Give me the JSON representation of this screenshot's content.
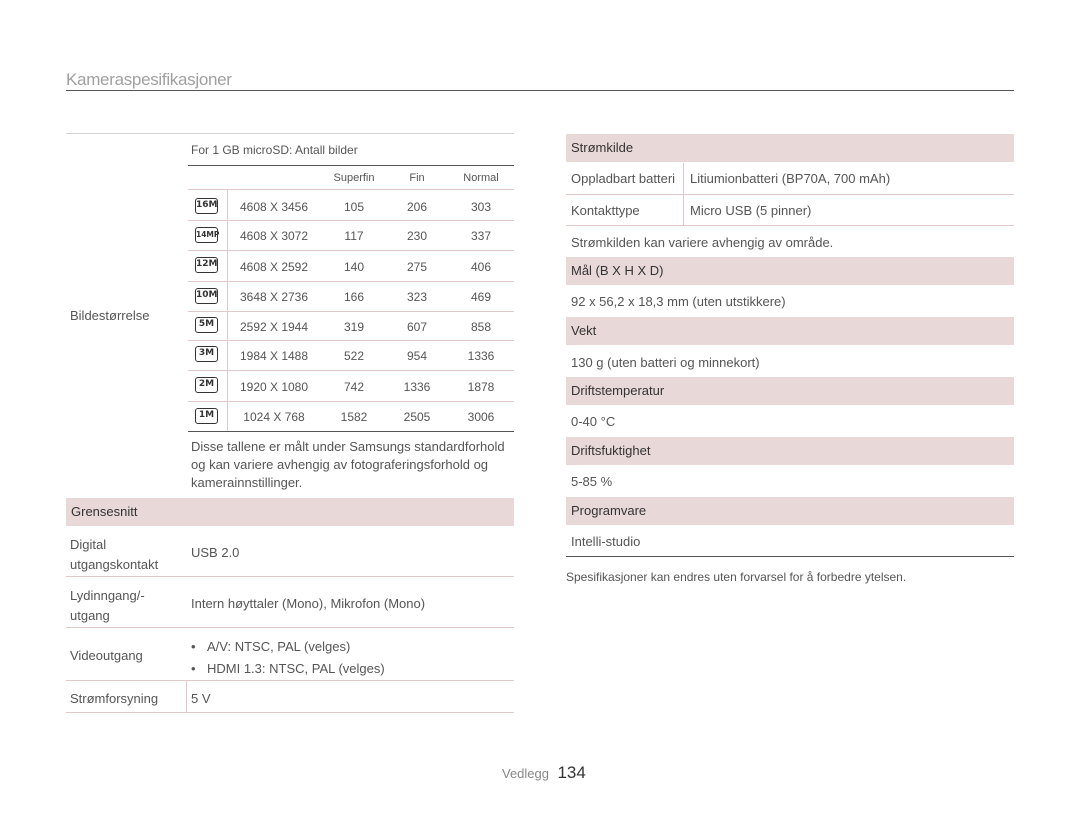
{
  "page_title": "Kameraspesifikasjoner",
  "left": {
    "image_size": {
      "label": "Bildestørrelse",
      "header": "For 1 GB microSD: Antall bilder",
      "columns": [
        "Superfin",
        "Fin",
        "Normal"
      ],
      "rows": [
        {
          "icon": "16m-size-icon",
          "icon_text": "16M",
          "res": "4608 X 3456",
          "superfin": "105",
          "fin": "206",
          "normal": "303"
        },
        {
          "icon": "14mp-size-icon",
          "icon_text": "14MP",
          "res": "4608 X 3072",
          "superfin": "117",
          "fin": "230",
          "normal": "337"
        },
        {
          "icon": "12m-size-icon",
          "icon_text": "12M",
          "res": "4608 X 2592",
          "superfin": "140",
          "fin": "275",
          "normal": "406"
        },
        {
          "icon": "10m-size-icon",
          "icon_text": "10M",
          "res": "3648 X 2736",
          "superfin": "166",
          "fin": "323",
          "normal": "469"
        },
        {
          "icon": "5m-size-icon",
          "icon_text": "5M",
          "res": "2592 X 1944",
          "superfin": "319",
          "fin": "607",
          "normal": "858"
        },
        {
          "icon": "3m-size-icon",
          "icon_text": "3M",
          "res": "1984 X 1488",
          "superfin": "522",
          "fin": "954",
          "normal": "1336"
        },
        {
          "icon": "2m-size-icon",
          "icon_text": "2M",
          "res": "1920 X 1080",
          "superfin": "742",
          "fin": "1336",
          "normal": "1878"
        },
        {
          "icon": "1m-size-icon",
          "icon_text": "1M",
          "res": "1024 X 768",
          "superfin": "1582",
          "fin": "2505",
          "normal": "3006"
        }
      ],
      "note_lines": [
        "Disse tallene er målt under Samsungs standardforhold",
        "og kan variere avhengig av fotograferingsforhold og",
        "kamerainnstillinger."
      ]
    },
    "interface": {
      "title": "Grensesnitt",
      "digital_label_1": "Digital",
      "digital_label_2": "utgangskontakt",
      "digital_value": "USB 2.0",
      "audio_label_1": "Lydinngang/-",
      "audio_label_2": "utgang",
      "audio_value": "Intern høyttaler (Mono), Mikrofon (Mono)",
      "video_label": "Videoutgang",
      "video_values": [
        "A/V: NTSC, PAL (velges)",
        "HDMI 1.3: NTSC, PAL (velges)"
      ],
      "power_label": "Strømforsyning",
      "power_value": "5 V"
    }
  },
  "right": {
    "power_source": {
      "title": "Strømkilde",
      "battery_label": "Oppladbart batteri",
      "battery_value": "Litiumionbatteri (BP70A, 700 mAh)",
      "connector_label": "Kontakttype",
      "connector_value": "Micro USB (5 pinner)",
      "note": "Strømkilden kan variere avhengig av område."
    },
    "dimensions": {
      "title": "Mål (B X H X D)",
      "value": "92 x 56,2 x 18,3 mm (uten utstikkere)"
    },
    "weight": {
      "title": "Vekt",
      "value": "130 g (uten batteri og minnekort)"
    },
    "operating_temp": {
      "title": "Driftstemperatur",
      "value": "0-40 °C"
    },
    "operating_humidity": {
      "title": "Driftsfuktighet",
      "value": "5-85 %"
    },
    "software": {
      "title": "Programvare",
      "value": "Intelli-studio"
    },
    "disclaimer": "Spesifikasjoner kan endres uten forvarsel for å forbedre ytelsen."
  },
  "footer": {
    "section": "Vedlegg",
    "page": "134"
  }
}
